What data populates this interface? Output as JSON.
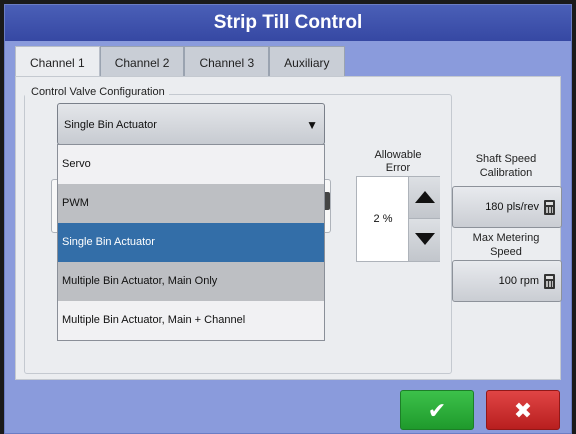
{
  "window": {
    "title": "Strip Till Control"
  },
  "tabs": [
    {
      "label": "Channel 1",
      "active": true
    },
    {
      "label": "Channel 2",
      "active": false
    },
    {
      "label": "Channel 3",
      "active": false
    },
    {
      "label": "Auxiliary",
      "active": false
    }
  ],
  "control_valve": {
    "legend": "Control Valve Configuration",
    "selected": "Single Bin Actuator",
    "dropdown_arrow_icon": "triangle-down",
    "options": [
      "Servo",
      "PWM",
      "Single Bin Actuator",
      "Multiple Bin Actuator, Main Only",
      "Multiple Bin Actuator, Main + Channel"
    ]
  },
  "allowable_error": {
    "label_line1": "Allowable",
    "label_line2": "Error",
    "value": "2 %",
    "up_icon": "triangle-up",
    "down_icon": "triangle-down"
  },
  "shaft_speed": {
    "label_line1": "Shaft Speed",
    "label_line2": "Calibration",
    "value": "180 pls/rev",
    "icon": "calculator-icon"
  },
  "max_metering": {
    "label_line1": "Max Metering",
    "label_line2": "Speed",
    "value": "100 rpm",
    "icon": "calculator-icon"
  },
  "footer": {
    "ok_symbol": "✔",
    "cancel_symbol": "✖",
    "ok_color": "#2db33b",
    "cancel_color": "#d03030"
  }
}
